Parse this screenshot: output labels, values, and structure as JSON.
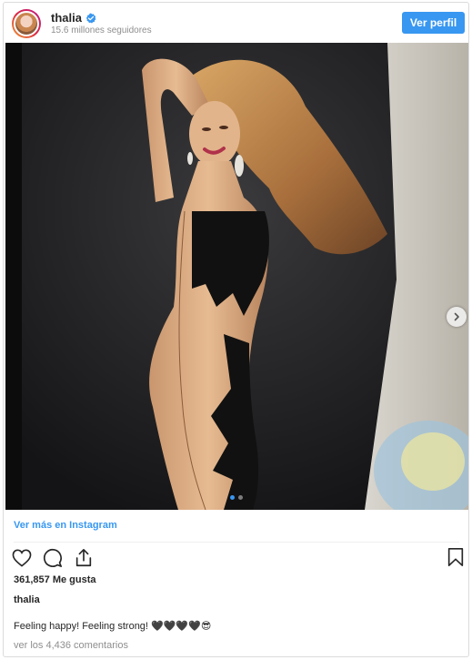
{
  "header": {
    "username": "thalia",
    "followers": "15.6 millones seguidores",
    "view_profile_label": "Ver perfil",
    "verified_icon": "verified-badge-icon",
    "accent_color": "#3897f0"
  },
  "photo": {
    "carousel_count": 2,
    "carousel_active_index": 0,
    "next_icon": "chevron-right-icon"
  },
  "footer": {
    "view_more_label": "Ver más en Instagram",
    "likes": "361,857 Me gusta",
    "caption_user": "thalia",
    "caption": "Feeling happy! Feeling strong! 🖤🖤🖤🖤😎",
    "comments_link": "ver los 4,436 comentarios",
    "icons": [
      "heart-icon",
      "comment-icon",
      "share-icon",
      "bookmark-icon"
    ]
  }
}
